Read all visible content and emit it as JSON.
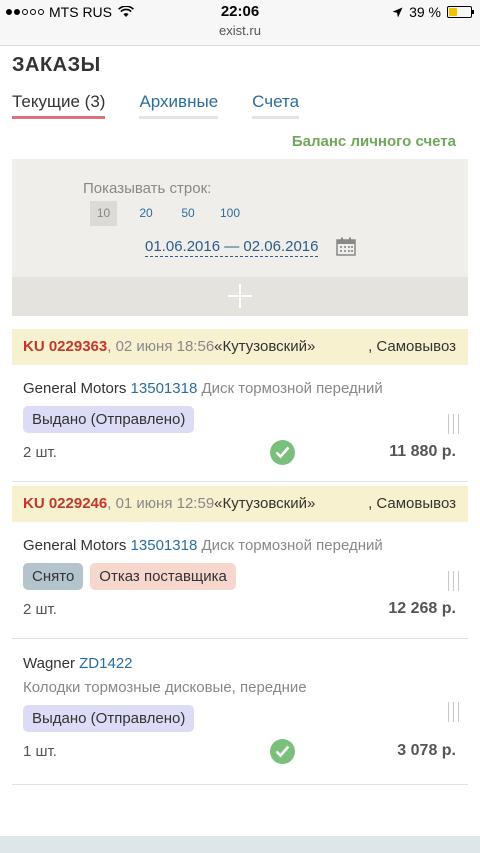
{
  "status_bar": {
    "carrier": "MTS RUS",
    "time": "22:06",
    "url": "exist.ru",
    "battery": "39 %",
    "battery_level": 0.39
  },
  "page_title": "ЗАКАЗЫ",
  "tabs": [
    {
      "label": "Текущие (3)",
      "active": true
    },
    {
      "label": "Архивные",
      "active": false
    },
    {
      "label": "Счета",
      "active": false
    }
  ],
  "balance_link": "Баланс личного счета",
  "filter": {
    "rows_label": "Показывать строк:",
    "rows_options": [
      "10",
      "20",
      "50",
      "100"
    ],
    "rows_selected": "10",
    "date_range": "01.06.2016 — 02.06.2016"
  },
  "orders": [
    {
      "number": "KU 0229363",
      "date": ", 02 июня 18:56",
      "store": "«Кутузовский»",
      "delivery": ", Самовывоз",
      "items": [
        {
          "brand": "General Motors",
          "code": "13501318",
          "description": "Диск тормозной передний",
          "statuses": [
            "Выдано (Отправлено)"
          ],
          "quantity": "2 шт.",
          "price": "11 880 р."
        }
      ]
    },
    {
      "number": "KU 0229246",
      "date": ", 01 июня 12:59",
      "store": "«Кутузовский»",
      "delivery": ", Самовывоз",
      "items": [
        {
          "brand": "General Motors",
          "code": "13501318",
          "description": "Диск тормозной передний",
          "statuses": [
            "Снято",
            "Отказ поставщика"
          ],
          "quantity": "2 шт.",
          "price": "12 268 р."
        },
        {
          "brand": "Wagner",
          "code": "ZD1422",
          "description": "Колодки тормозные дисковые, передние",
          "statuses": [
            "Выдано (Отправлено)"
          ],
          "quantity": "1 шт.",
          "price": "3 078 р."
        }
      ]
    }
  ],
  "colors": {
    "accent_link": "#2b6d9c",
    "order_number": "#c0392b",
    "balance": "#6fa85a",
    "check": "#7bbf7d"
  }
}
